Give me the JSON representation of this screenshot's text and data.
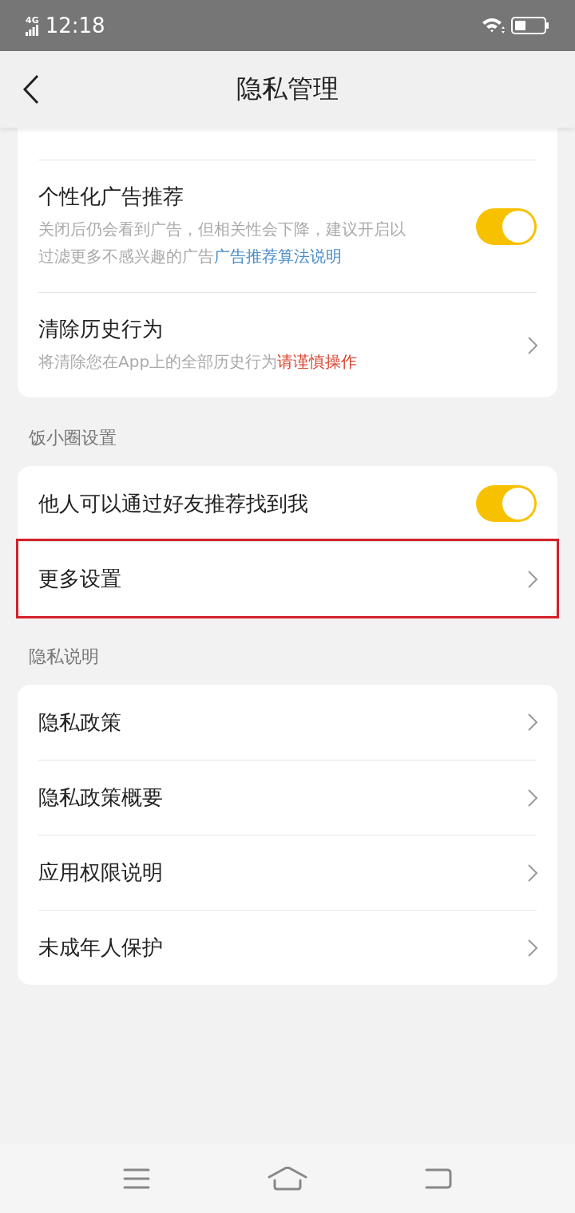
{
  "status_bar": {
    "network": "4G",
    "time": "12:18"
  },
  "header": {
    "title": "隐私管理"
  },
  "sections": [
    {
      "items": [
        {
          "kind": "toggle",
          "title": "个性化广告推荐",
          "description": "关闭后仍会看到广告，但相关性会下降，建议开启以过滤更多不感兴趣的广告",
          "link": "广告推荐算法说明",
          "on": true,
          "highlighted": false
        },
        {
          "kind": "link",
          "title": "清除历史行为",
          "description": "将清除您在App上的全部历史行为",
          "warning": "请谨慎操作",
          "highlighted": false
        }
      ]
    },
    {
      "label": "饭小圈设置",
      "items": [
        {
          "kind": "toggle",
          "title": "他人可以通过好友推荐找到我",
          "on": true,
          "highlighted": false
        },
        {
          "kind": "link",
          "title": "更多设置",
          "highlighted": true
        }
      ]
    },
    {
      "label": "隐私说明",
      "items": [
        {
          "kind": "link",
          "title": "隐私政策",
          "highlighted": false
        },
        {
          "kind": "link",
          "title": "隐私政策概要",
          "highlighted": false
        },
        {
          "kind": "link",
          "title": "应用权限说明",
          "highlighted": false
        },
        {
          "kind": "link",
          "title": "未成年人保护",
          "highlighted": false
        }
      ]
    }
  ]
}
